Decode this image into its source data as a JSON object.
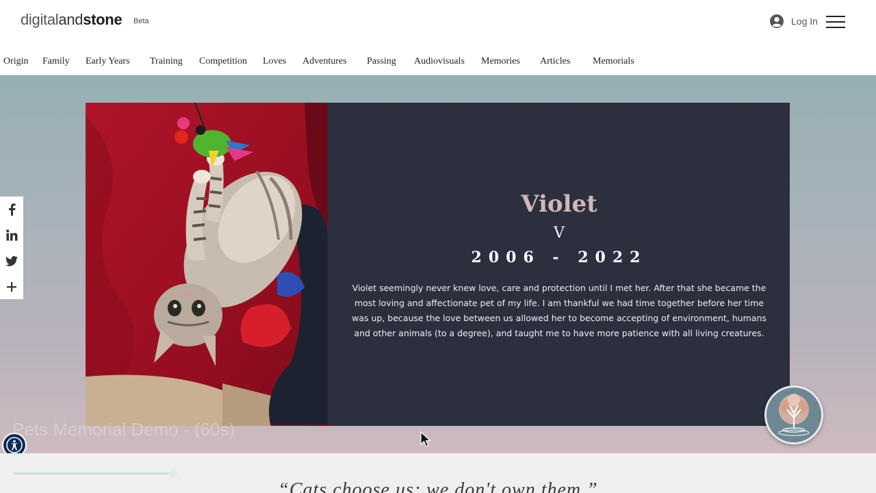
{
  "header": {
    "logo": {
      "part1": "digital",
      "part2": "and",
      "part3": "stone"
    },
    "beta": "Beta",
    "login_label": "Log In"
  },
  "nav": {
    "items": [
      "Origin",
      "Family",
      "Early Years",
      "Training",
      "Competition",
      "Loves",
      "Adventures",
      "Passing",
      "Audiovisuals",
      "Memories",
      "Articles",
      "Memorials"
    ]
  },
  "memorial": {
    "name": "Violet",
    "initial": "V",
    "years": "2006 - 2022",
    "bio": "Violet seemingly never knew love, care and protection until I met her. After that she became the most loving and affectionate pet of my life. I am thankful we had time together before her time was up, because the love between us allowed her to become accepting of environment, humans and other animals (to a degree), and taught me to have more patience with all living creatures."
  },
  "share": {
    "icons": [
      "facebook-icon",
      "linkedin-icon",
      "twitter-icon",
      "plus-icon"
    ]
  },
  "overlay": {
    "video_title": "Pets Memorial Demo - (60s)"
  },
  "quote": {
    "text": "“Cats choose us; we don't own them.”"
  },
  "colors": {
    "card_bg": "#2b2f3e",
    "name_color": "#cfb8b5",
    "accessibility_bg": "#0d2b58"
  }
}
